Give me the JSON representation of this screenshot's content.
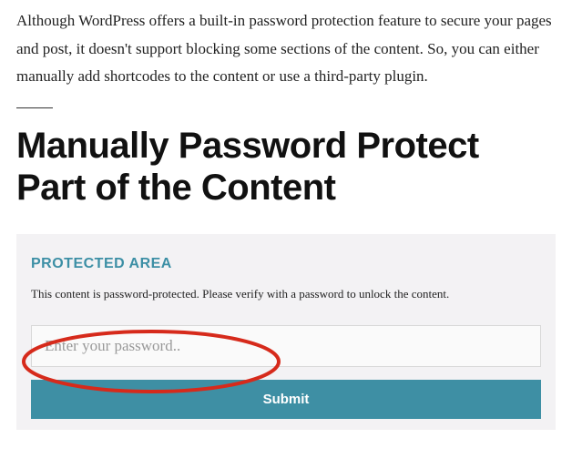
{
  "intro": {
    "paragraph": "Although WordPress offers a built-in password protection feature to secure your pages and post, it doesn't support blocking some sections of the content. So, you can either manually add shortcodes to the content or use a third-party plugin."
  },
  "heading": "Manually Password Protect Part of the Content",
  "protected": {
    "title": "PROTECTED AREA",
    "description": "This content is password-protected. Please verify with a password to unlock the content.",
    "placeholder": "Enter your password..",
    "submit_label": "Submit"
  },
  "annotation": {
    "color": "#d62a1b"
  }
}
